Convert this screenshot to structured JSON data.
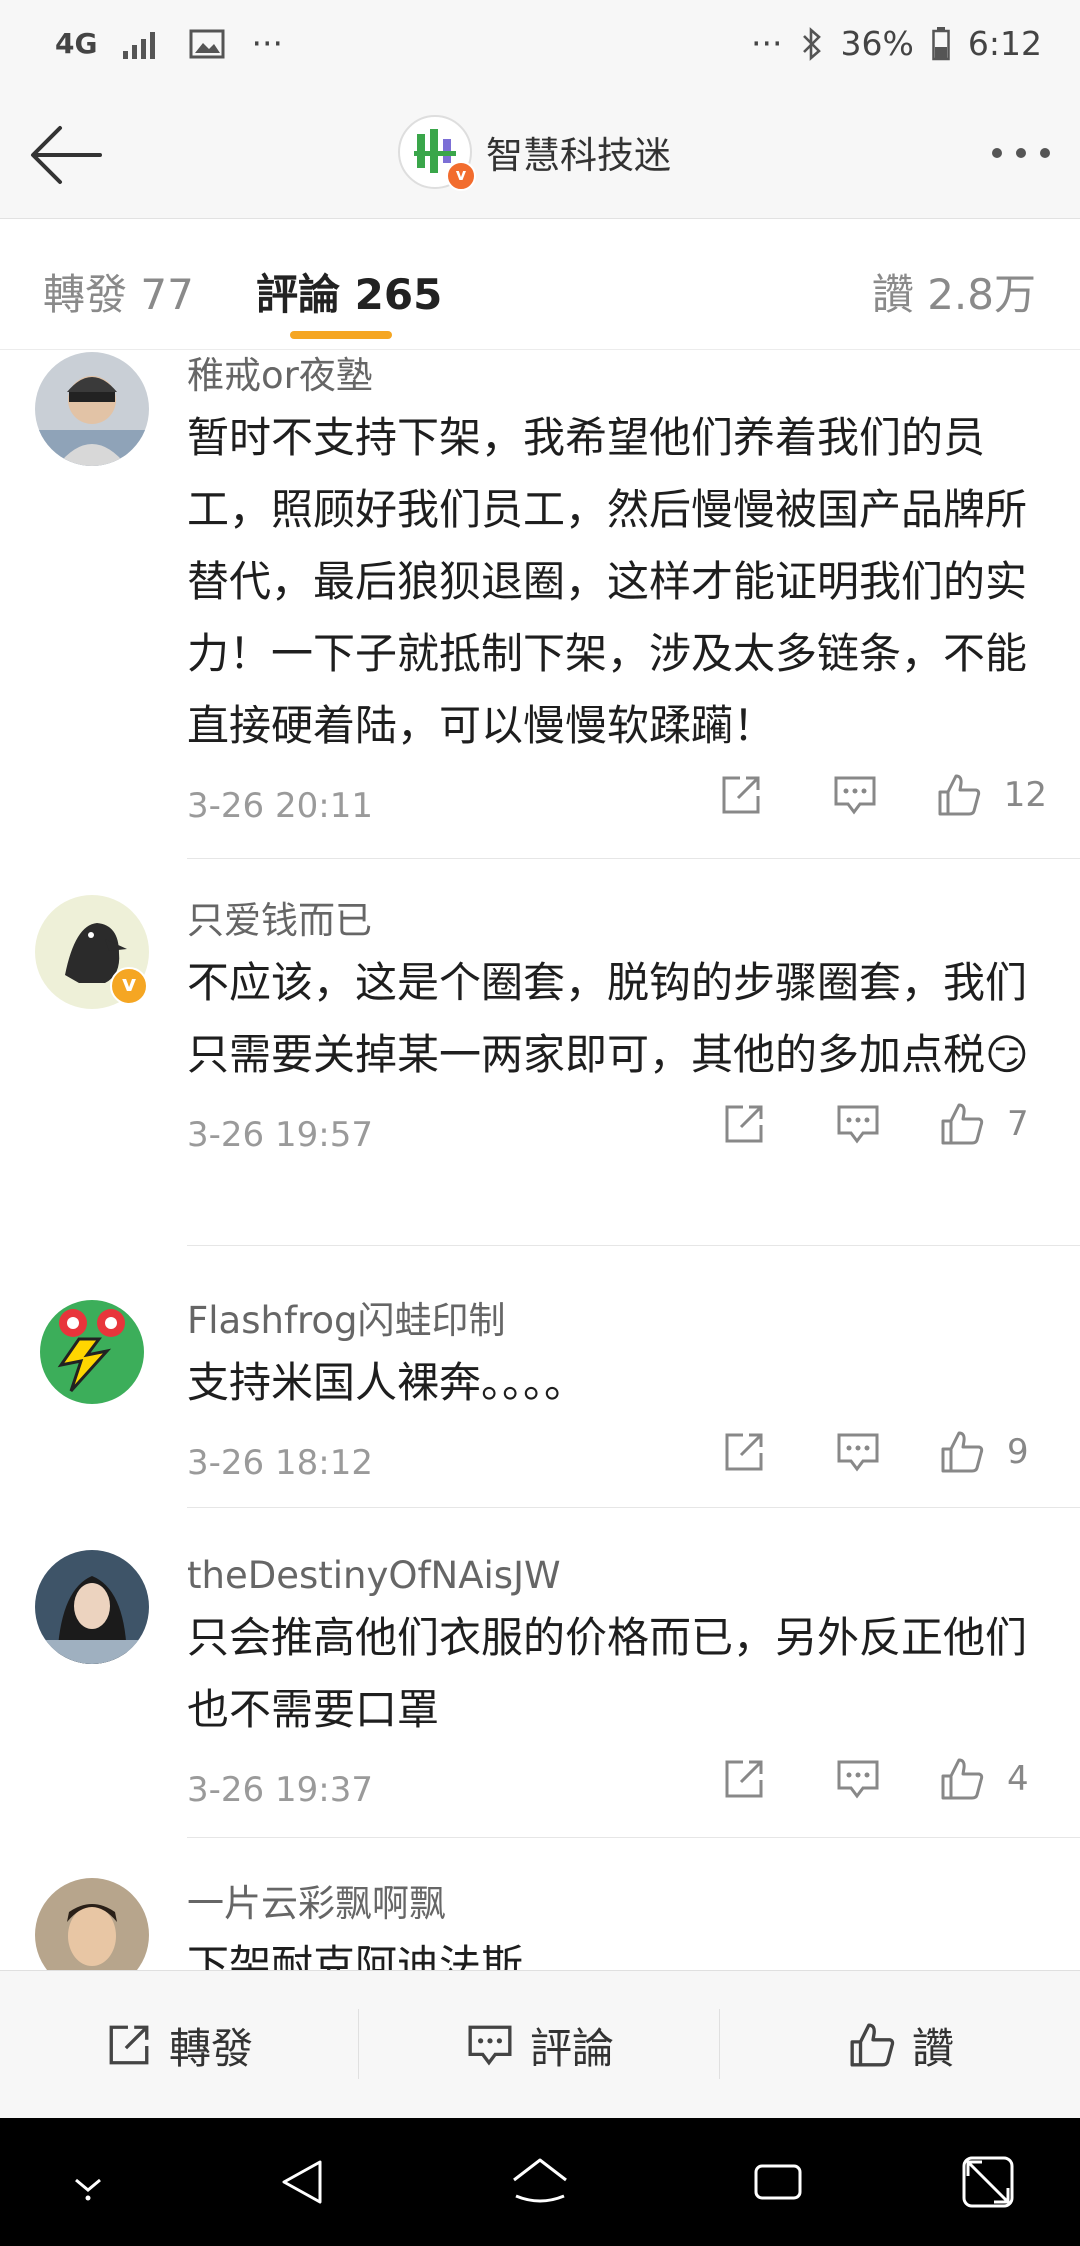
{
  "status_bar": {
    "network": "4G",
    "dots_left": "···",
    "dots_right": "···",
    "battery": "36%",
    "time": "6:12"
  },
  "nav": {
    "title": "智慧科技迷"
  },
  "tabs": {
    "forward": "轉發 77",
    "comments": "評論 265",
    "likes": "讚 2.8万"
  },
  "comments": [
    {
      "user": "稚戒or夜塾",
      "text": "暂时不支持下架，我希望他们养着我们的员工，照顾好我们员工，然后慢慢被国产品牌所替代，最后狼狈退圈，这样才能证明我们的实力！一下子就抵制下架，涉及太多链条，不能直接硬着陆，可以慢慢软蹂躏！",
      "time": "3-26 20:11",
      "likes": "12"
    },
    {
      "user": "只爱钱而已",
      "text": "不应该，这是个圈套，脱钩的步骤圈套，我们只需要关掉某一两家即可，其他的多加点税😏",
      "time": "3-26 19:57",
      "likes": "7"
    },
    {
      "user": "Flashfrog闪蛙印制",
      "text": "支持米国人裸奔。。。。",
      "time": "3-26 18:12",
      "likes": "9"
    },
    {
      "user": "theDestinyOfNAisJW",
      "text": "只会推高他们衣服的价格而已，另外反正他们也不需要口罩",
      "time": "3-26 19:37",
      "likes": "4"
    },
    {
      "user": "一片云彩飘啊飘",
      "text": "下架耐克阿迪法斯",
      "time": "",
      "likes": ""
    }
  ],
  "bottom_bar": {
    "forward": "轉發",
    "comment": "評論",
    "like": "讚"
  },
  "colors": {
    "accent": "#f5a623",
    "verified": "#f26c2e"
  }
}
